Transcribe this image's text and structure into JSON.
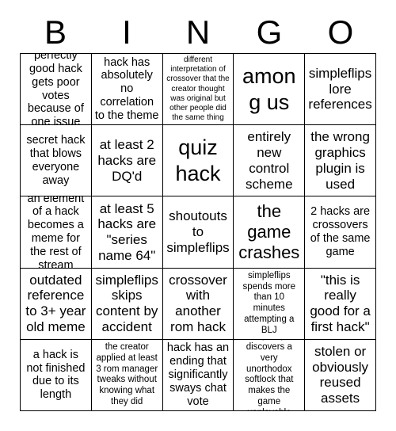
{
  "card": {
    "header_letters": [
      "B",
      "I",
      "N",
      "G",
      "O"
    ],
    "columns": 5,
    "rows": 5,
    "colors": {
      "background": "#ffffff",
      "text": "#000000",
      "grid_line": "#000000"
    },
    "cells": [
      {
        "text": "perfectly good hack gets poor votes because of one issue",
        "size": "md",
        "marked": false
      },
      {
        "text": "hack has absolutely no correlation to the theme",
        "size": "md",
        "marked": false
      },
      {
        "text": "different interpretation of crossover that the creator thought was original but other people did the same thing",
        "size": "xs",
        "marked": false
      },
      {
        "text": "among us",
        "size": "xxl",
        "marked": false
      },
      {
        "text": "simpleflips lore references",
        "size": "lg",
        "marked": false
      },
      {
        "text": "secret hack that blows everyone away",
        "size": "md",
        "marked": false
      },
      {
        "text": "at least 2 hacks are DQ'd",
        "size": "lg",
        "marked": false
      },
      {
        "text": "quiz hack",
        "size": "xxl",
        "marked": false
      },
      {
        "text": "entirely new control scheme",
        "size": "lg",
        "marked": false
      },
      {
        "text": "the wrong graphics plugin is used",
        "size": "lg",
        "marked": false
      },
      {
        "text": "an element of a hack becomes a meme for the rest of stream",
        "size": "md",
        "marked": false
      },
      {
        "text": "at least 5 hacks are \"series name 64\"",
        "size": "lg",
        "marked": false
      },
      {
        "text": "shoutouts to simpleflips",
        "size": "lg",
        "marked": false
      },
      {
        "text": "the game crashes",
        "size": "xl",
        "marked": false
      },
      {
        "text": "2 hacks are crossovers of the same game",
        "size": "md",
        "marked": false
      },
      {
        "text": "outdated reference to 3+ year old meme",
        "size": "lg",
        "marked": false
      },
      {
        "text": "simpleflips skips content by accident",
        "size": "lg",
        "marked": false
      },
      {
        "text": "crossover with another rom hack",
        "size": "lg",
        "marked": false
      },
      {
        "text": "simpleflips spends more than 10 minutes attempting a BLJ",
        "size": "sm",
        "marked": false
      },
      {
        "text": "\"this is really good for a first hack\"",
        "size": "lg",
        "marked": false
      },
      {
        "text": "a hack is not finished due to its length",
        "size": "md",
        "marked": false
      },
      {
        "text": "the creator applied at least 3 rom manager tweaks without knowing what they did",
        "size": "sm",
        "marked": false
      },
      {
        "text": "hack has an ending that significantly sways chat vote",
        "size": "md",
        "marked": false
      },
      {
        "text": "simpleflips discovers a very unorthodox softlock that makes the game unplayable",
        "size": "sm",
        "marked": false
      },
      {
        "text": "stolen or obviously reused assets",
        "size": "lg",
        "marked": false
      }
    ]
  }
}
